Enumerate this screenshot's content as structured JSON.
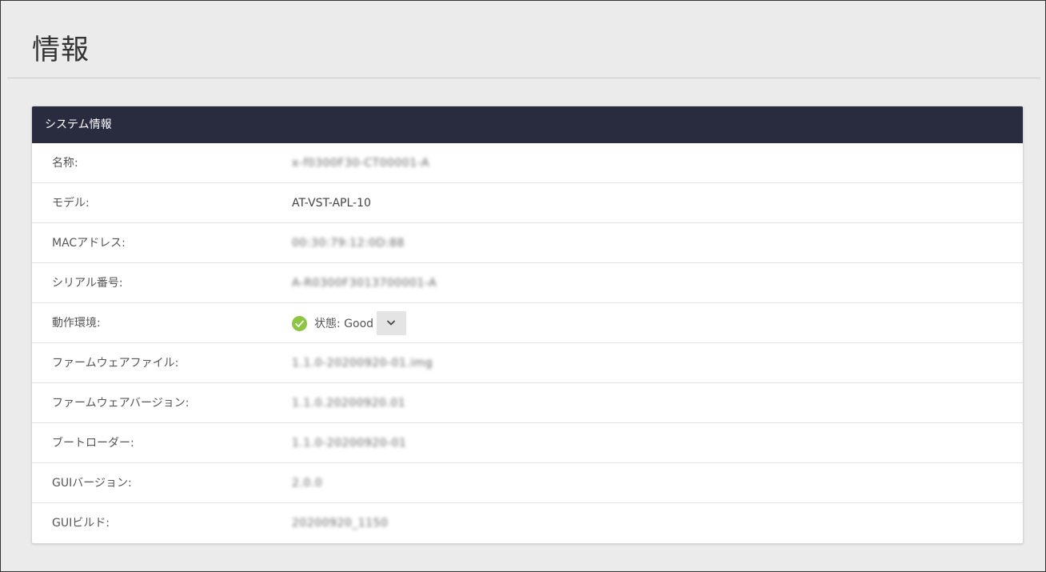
{
  "header": {
    "title": "情報"
  },
  "panel": {
    "title": "システム情報",
    "rows": [
      {
        "label": "名称:",
        "value": "x-f0300F30-CT00001-A"
      },
      {
        "label": "モデル:",
        "value": "AT-VST-APL-10"
      },
      {
        "label": "MACアドレス:",
        "value": "00:30:79:12:0D:88"
      },
      {
        "label": "シリアル番号:",
        "value": "A-R0300F3013700001-A"
      },
      {
        "label": "動作環境:",
        "status": "状態: Good",
        "status_icon": "check-circle-icon",
        "status_color": "#8dc63f"
      },
      {
        "label": "ファームウェアファイル:",
        "value": "1.1.0-20200920-01.img"
      },
      {
        "label": "ファームウェアバージョン:",
        "value": "1.1.0.20200920.01"
      },
      {
        "label": "ブートローダー:",
        "value": "1.1.0-20200920-01"
      },
      {
        "label": "GUIバージョン:",
        "value": "2.0.0"
      },
      {
        "label": "GUIビルド:",
        "value": "20200920_1150"
      }
    ]
  },
  "colors": {
    "background": "#ebebeb",
    "panel_header": "#292b3e",
    "status_good": "#8dc63f"
  }
}
